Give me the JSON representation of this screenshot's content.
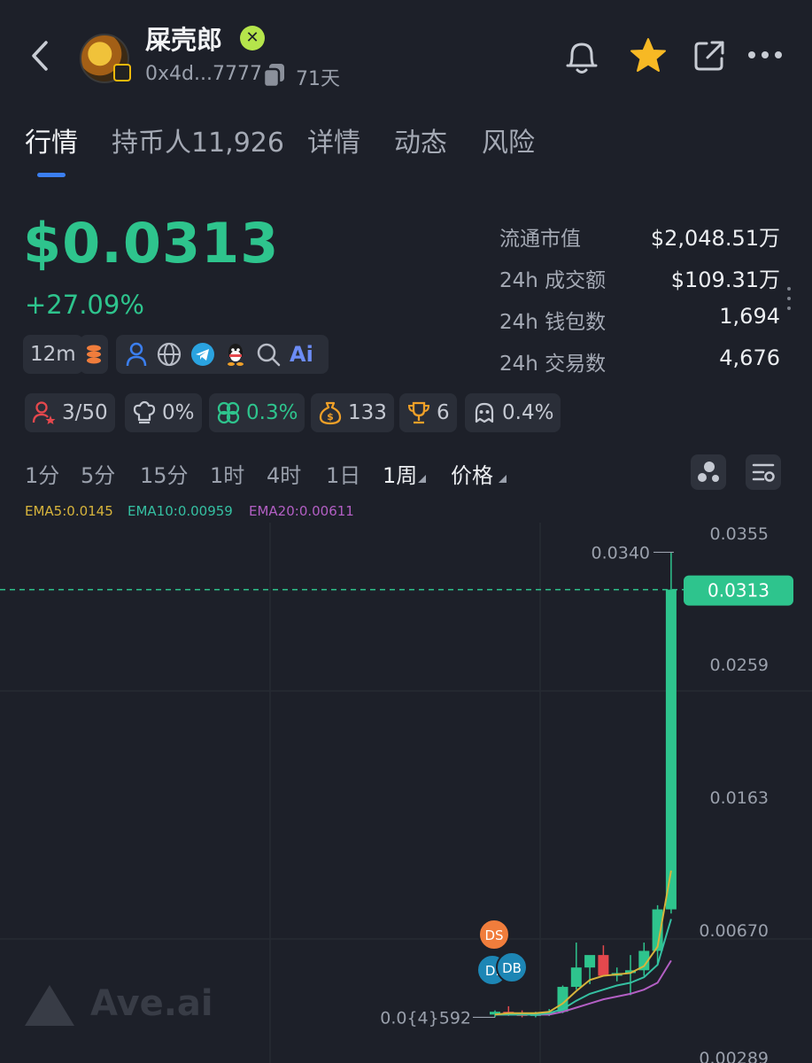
{
  "header": {
    "title": "屎壳郎",
    "address": "0x4d...7777",
    "age": "71天"
  },
  "tabs": [
    {
      "label": "行情"
    },
    {
      "label": "持币人11,926"
    },
    {
      "label": "详情"
    },
    {
      "label": "动态"
    },
    {
      "label": "风险"
    }
  ],
  "price": {
    "value": "$0.0313",
    "change": "+27.09%"
  },
  "stats": [
    {
      "label": "流通市值",
      "value": "$2,048.51万"
    },
    {
      "label": "24h 成交额",
      "value": "$109.31万"
    },
    {
      "label": "24h 钱包数",
      "value": "1,694"
    },
    {
      "label": "24h 交易数",
      "value": "4,676"
    }
  ],
  "meta_chips": {
    "age_label": "12m",
    "ai_label": "Ai"
  },
  "metric_chips": [
    {
      "icon": "user-star-icon",
      "value": "3/50",
      "color": "#e5484d"
    },
    {
      "icon": "chef-hat-icon",
      "value": "0%",
      "color": "#c5c9d2"
    },
    {
      "icon": "bundle-icon",
      "value": "0.3%",
      "color": "#2ec48d"
    },
    {
      "icon": "money-bag-icon",
      "value": "133",
      "color": "#f0a028"
    },
    {
      "icon": "trophy-icon",
      "value": "6",
      "color": "#f0a028"
    },
    {
      "icon": "sniper-icon",
      "value": "0.4%",
      "color": "#c5c9d2"
    }
  ],
  "intervals": [
    "1分",
    "5分",
    "15分",
    "1时",
    "4时",
    "1日",
    "1周",
    "价格"
  ],
  "active_interval": "1周",
  "ema": {
    "ema5": "EMA5:0.0145",
    "ema10": "EMA10:0.00959",
    "ema20": "EMA20:0.00611"
  },
  "colors": {
    "up": "#2ec48d",
    "down": "#e5484d",
    "ema5": "#d7b43c",
    "ema10": "#35c0a2",
    "ema20": "#b35fc4",
    "accent": "#3b7ff0"
  },
  "chart_data": {
    "type": "candlestick",
    "y_axis_ticks": [
      "0.0355",
      "0.0259",
      "0.0163",
      "0.00670",
      "0.00289"
    ],
    "current_price_label": "0.0313",
    "high_label": "0.0340",
    "low_label": "0.0{4}592",
    "watermark": "Ave.ai",
    "markers": [
      "DS",
      "D.",
      "DB"
    ],
    "candles": [
      {
        "o": 0.0006,
        "h": 0.0009,
        "l": 0.0004,
        "c": 0.0008
      },
      {
        "o": 0.0008,
        "h": 0.0012,
        "l": 0.0005,
        "c": 0.0007
      },
      {
        "o": 0.0007,
        "h": 0.0009,
        "l": 0.0004,
        "c": 0.0005
      },
      {
        "o": 0.0005,
        "h": 0.0008,
        "l": 0.0004,
        "c": 0.0007
      },
      {
        "o": 0.0007,
        "h": 0.001,
        "l": 0.0005,
        "c": 0.0008
      },
      {
        "o": 0.0008,
        "h": 0.0027,
        "l": 0.0007,
        "c": 0.0026
      },
      {
        "o": 0.0026,
        "h": 0.0058,
        "l": 0.0024,
        "c": 0.004
      },
      {
        "o": 0.004,
        "h": 0.0048,
        "l": 0.0028,
        "c": 0.0049
      },
      {
        "o": 0.0049,
        "h": 0.0056,
        "l": 0.0034,
        "c": 0.0034
      },
      {
        "o": 0.0034,
        "h": 0.004,
        "l": 0.003,
        "c": 0.0036
      },
      {
        "o": 0.0036,
        "h": 0.0049,
        "l": 0.002,
        "c": 0.0038
      },
      {
        "o": 0.0038,
        "h": 0.0058,
        "l": 0.0034,
        "c": 0.0052
      },
      {
        "o": 0.0052,
        "h": 0.0085,
        "l": 0.0042,
        "c": 0.0082
      },
      {
        "o": 0.0082,
        "h": 0.034,
        "l": 0.0079,
        "c": 0.0313
      }
    ],
    "ema5_values": [
      0.0006,
      0.0007,
      0.0007,
      0.0007,
      0.0008,
      0.0014,
      0.0023,
      0.0031,
      0.0034,
      0.0035,
      0.0036,
      0.0041,
      0.0055,
      0.011
    ],
    "ema10_values": [
      0.0006,
      0.0006,
      0.0006,
      0.0006,
      0.0007,
      0.001,
      0.0016,
      0.0021,
      0.0024,
      0.0027,
      0.0029,
      0.0033,
      0.0042,
      0.0075
    ],
    "ema20_values": [
      0.0006,
      0.0006,
      0.0006,
      0.0006,
      0.0006,
      0.0008,
      0.0011,
      0.0014,
      0.0017,
      0.0019,
      0.0021,
      0.0024,
      0.0029,
      0.0045
    ]
  }
}
